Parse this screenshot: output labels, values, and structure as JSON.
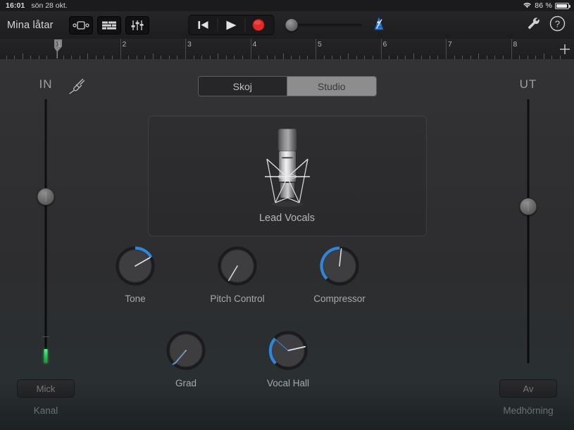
{
  "statusbar": {
    "time": "16:01",
    "date": "sön 28 okt.",
    "battery_percent": "86 %",
    "wifi_icon": "wifi-icon",
    "battery_icon": "battery-icon"
  },
  "toolbar": {
    "title": "Mina låtar",
    "icons": [
      {
        "name": "instrument-view-icon",
        "label": "instrument-view"
      },
      {
        "name": "tracks-view-icon",
        "label": "tracks-view"
      },
      {
        "name": "mixer-icon",
        "label": "mixer"
      }
    ],
    "transport": {
      "rewind_label": "rewind-icon",
      "play_label": "play-icon",
      "record_label": "record-icon",
      "record_color": "#e02b28"
    },
    "master_volume": {
      "name": "master-volume-slider",
      "value_percent": 2
    },
    "metronome": {
      "name": "metronome-icon",
      "active": true,
      "color": "#1f6fe0"
    },
    "settings_icon": "wrench-icon",
    "help_icon": "help-icon"
  },
  "ruler": {
    "bars": [
      "1",
      "2",
      "3",
      "4",
      "5",
      "6",
      "7",
      "8"
    ],
    "playhead_bar": "1",
    "add_button": "+"
  },
  "tabs": {
    "items": [
      {
        "label": "Skoj",
        "selected": false
      },
      {
        "label": "Studio",
        "selected": true
      }
    ]
  },
  "instrument": {
    "name": "Lead Vocals",
    "icon": "condenser-microphone-icon"
  },
  "knobs": [
    {
      "label": "Tone",
      "angle": 62,
      "arc_start": 0,
      "arc_end": 62,
      "has_arc": true
    },
    {
      "label": "Pitch Control",
      "angle": 215,
      "arc_start": 215,
      "arc_end": 215,
      "has_arc": false
    },
    {
      "label": "Compressor",
      "angle": 6,
      "arc_start": 228,
      "arc_end": 366,
      "has_arc": true
    },
    {
      "label": "Grad",
      "angle": 222,
      "arc_start": 222,
      "arc_end": 228,
      "has_arc": true
    },
    {
      "label": "Vocal Hall",
      "angle": 78,
      "arc_start": 224,
      "arc_end": 318,
      "has_arc": true
    }
  ],
  "input_strip": {
    "caption": "IN",
    "plug_icon": "audio-plug-icon",
    "fader_value_percent": 33,
    "level_meter_percent": 6,
    "button_label": "Mick",
    "sub_label": "Kanal"
  },
  "output_strip": {
    "caption": "UT",
    "fader_value_percent": 37,
    "button_label": "Av",
    "sub_label": "Medhörning"
  },
  "colors": {
    "accent_blue": "#2f86d8",
    "record_red": "#e02b28",
    "meter_green": "#2ecb59",
    "background": "#313133"
  }
}
